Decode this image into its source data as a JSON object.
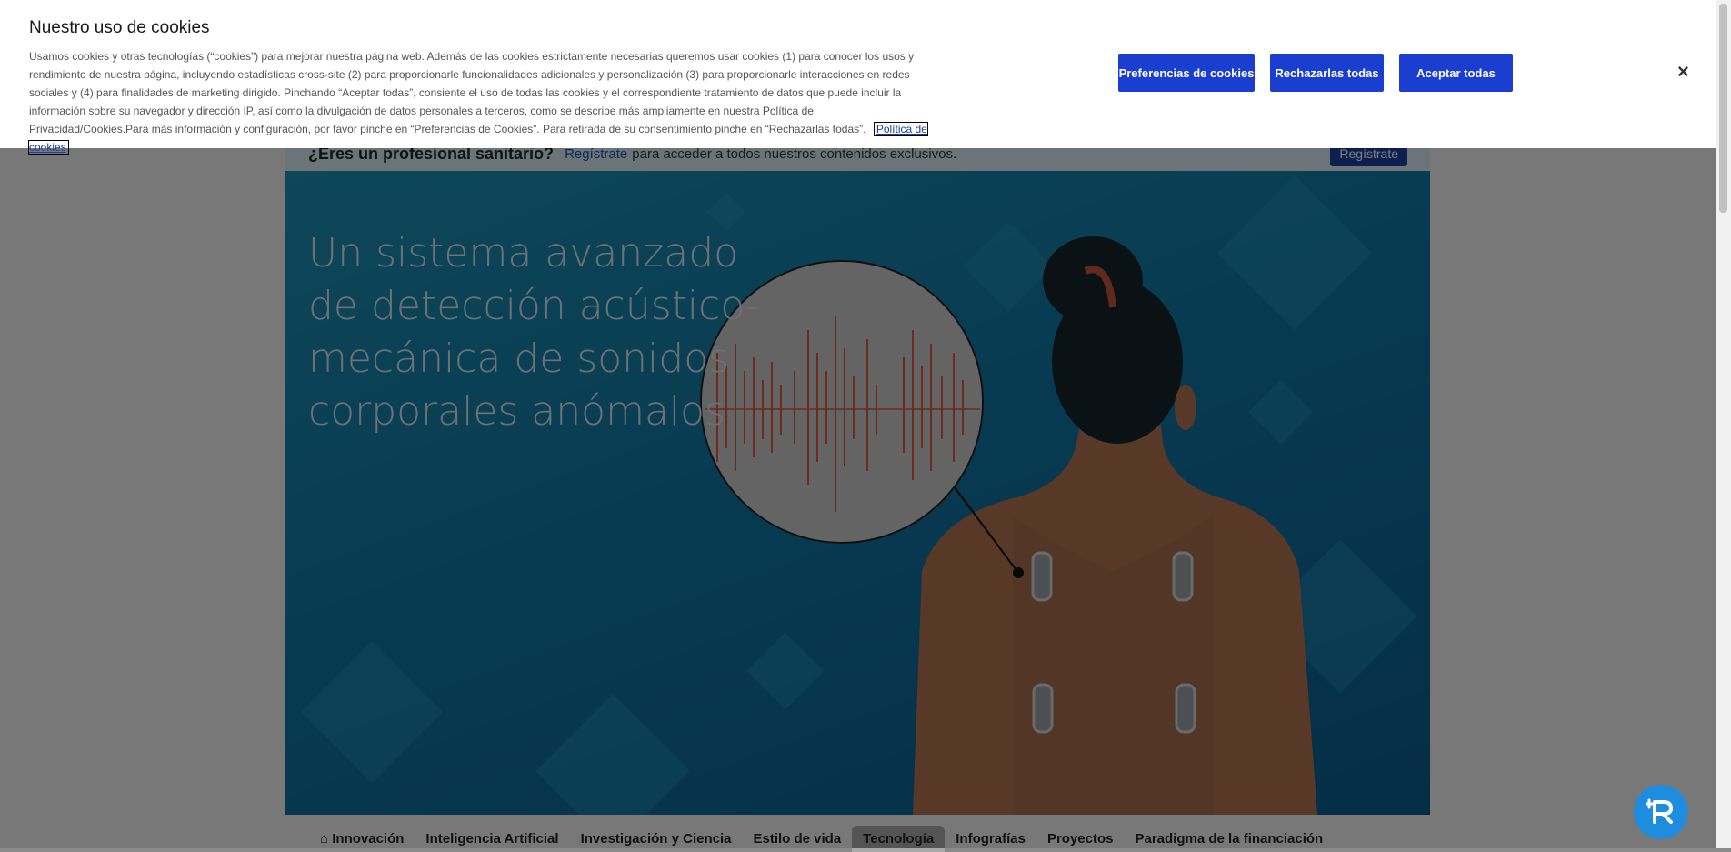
{
  "banner": {
    "question": "¿Eres un profesional sanitario?",
    "link": "Regístrate",
    "text": "para acceder a todos nuestros contenidos exclusivos.",
    "button": "Regístrate"
  },
  "hero": {
    "title": "Un sistema avanzado de detección acústico-mecánica de sonidos corporales anómalos"
  },
  "nav": {
    "items": [
      "Innovación",
      "Inteligencia Artificial",
      "Investigación y Ciencia",
      "Estilo de vida",
      "Tecnología",
      "Infografías",
      "Proyectos",
      "Paradigma de la financiación"
    ],
    "active": "Tecnología"
  },
  "cookie": {
    "title": "Nuestro uso de cookies",
    "text": "Usamos cookies y otras tecnologías (“cookies”) para mejorar nuestra página web. Además de las cookies estrictamente necesarias queremos usar cookies (1) para conocer los usos y rendimiento de nuestra página, incluyendo estadísticas cross-site (2) para proporcionarle funcionalidades adicionales y personalización (3) para proporcionarle interacciones en redes sociales y (4) para finalidades de marketing dirigido. Pinchando “Aceptar todas”, consiente el uso de todas las cookies y el correspondiente tratamiento de datos que puede incluir la información sobre su navegador y dirección IP, así como la divulgación de datos personales a terceros, como se describe más ampliamente en nuestra Política de Privacidad/Cookies.Para más información y configuración, por favor pinche en “Preferencias de Cookies”. Para retirada de su consentimiento pinche en “Rechazarlas todas”.",
    "policy_link": "Política de cookies",
    "btn_prefs": "Preferencias de cookies",
    "btn_reject": "Rechazarlas todas",
    "btn_accept": "Aceptar todas",
    "close": "×"
  },
  "colors": {
    "primary_button": "#1a3fd0",
    "hero_bg": "#0f76a3",
    "waveform": "#d9573a",
    "fab": "#1e8de0"
  }
}
